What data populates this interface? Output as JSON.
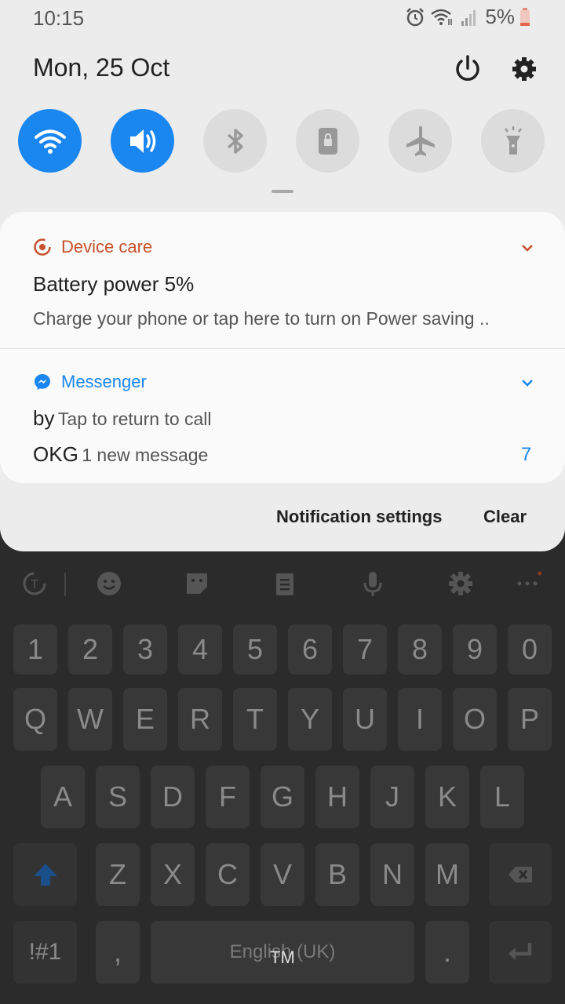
{
  "status_bar": {
    "time": "10:15",
    "battery": "5%",
    "icons": [
      "alarm-icon",
      "wifi-icon",
      "signal-icon",
      "battery-icon"
    ]
  },
  "header": {
    "date": "Mon, 25 Oct",
    "power_icon": "power-icon",
    "settings_icon": "gear-icon"
  },
  "quick_settings": [
    {
      "name": "wifi",
      "state": "on"
    },
    {
      "name": "sound",
      "state": "on"
    },
    {
      "name": "bluetooth",
      "state": "off"
    },
    {
      "name": "screen-lock",
      "state": "off"
    },
    {
      "name": "airplane-mode",
      "state": "off"
    },
    {
      "name": "flashlight",
      "state": "off"
    }
  ],
  "notifications": [
    {
      "app": "Device care",
      "app_color": "#c8502a",
      "title": "Battery power 5%",
      "text": "Charge your phone or tap here to turn on Power saving .."
    },
    {
      "app": "Messenger",
      "app_color": "#1a86f0",
      "lines": [
        {
          "sender": "by",
          "message": "Tap to return to call"
        },
        {
          "sender": "OKG",
          "message": "1 new message"
        }
      ],
      "count": "7"
    }
  ],
  "footer": {
    "settings_label": "Notification settings",
    "clear_label": "Clear"
  },
  "keyboard": {
    "number_row": [
      "1",
      "2",
      "3",
      "4",
      "5",
      "6",
      "7",
      "8",
      "9",
      "0"
    ],
    "row1": [
      "Q",
      "W",
      "E",
      "R",
      "T",
      "Y",
      "U",
      "I",
      "O",
      "P"
    ],
    "row2": [
      "A",
      "S",
      "D",
      "F",
      "G",
      "H",
      "J",
      "K",
      "L"
    ],
    "row3": [
      "Z",
      "X",
      "C",
      "V",
      "B",
      "N",
      "M"
    ],
    "symbols_label": "!#1",
    "comma": ",",
    "space_label": "English (UK)",
    "period": ".",
    "overlay_text": "TM"
  },
  "colors": {
    "accent": "#1a86f0",
    "device_care": "#c8502a"
  }
}
